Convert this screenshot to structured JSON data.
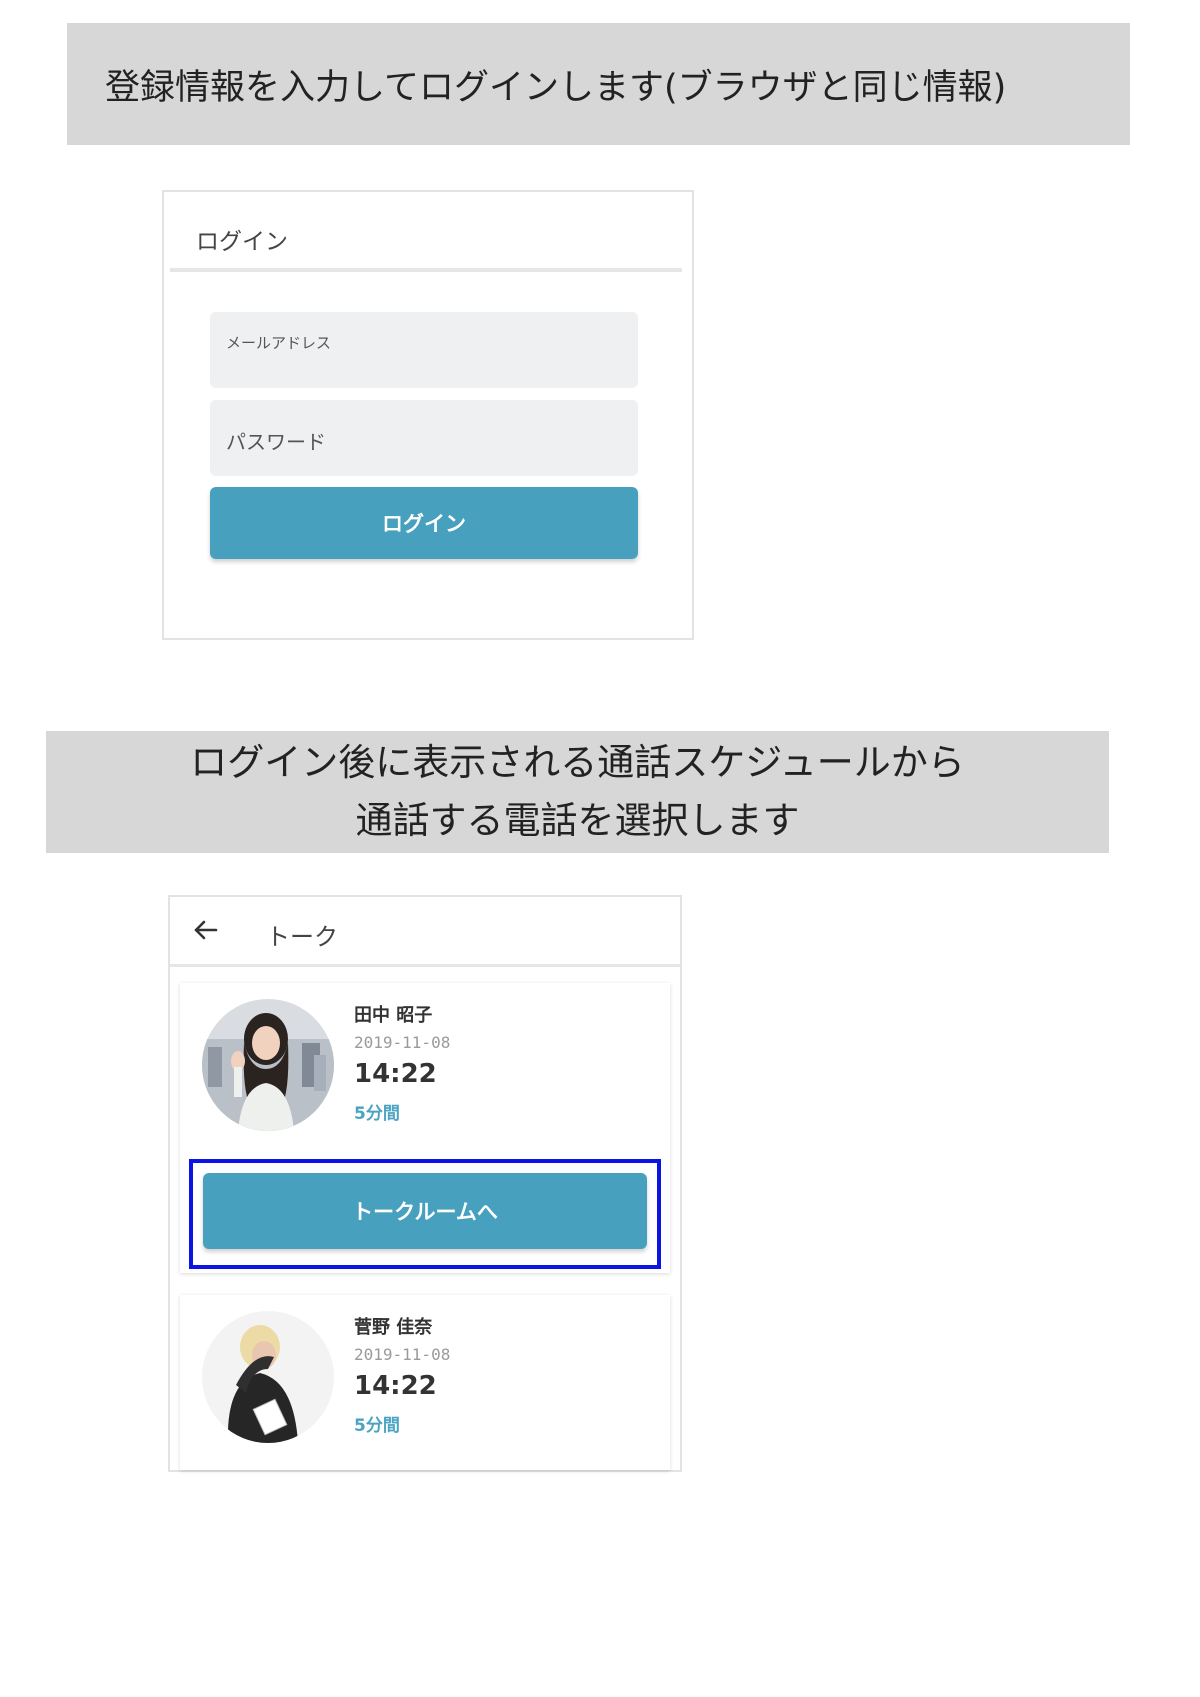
{
  "instructions": {
    "step1": "登録情報を入力してログインします(ブラウザと同じ情報)",
    "step2_line1": "ログイン後に表示される通話スケジュールから",
    "step2_line2": "通話する電話を選択します"
  },
  "login": {
    "title": "ログイン",
    "email_label": "メールアドレス",
    "password_label": "パスワード",
    "submit_label": "ログイン"
  },
  "talk": {
    "title": "トーク",
    "items": [
      {
        "name": "田中 昭子",
        "date": "2019-11-08",
        "time": "14:22",
        "duration": "5分間",
        "button_label": "トークルームへ"
      },
      {
        "name": "菅野 佳奈",
        "date": "2019-11-08",
        "time": "14:22",
        "duration": "5分間"
      }
    ]
  },
  "colors": {
    "banner_bg": "#d7d7d7",
    "accent": "#48a0bf",
    "highlight": "#0a14e6"
  },
  "icons": {
    "back": "arrow-left-icon"
  }
}
